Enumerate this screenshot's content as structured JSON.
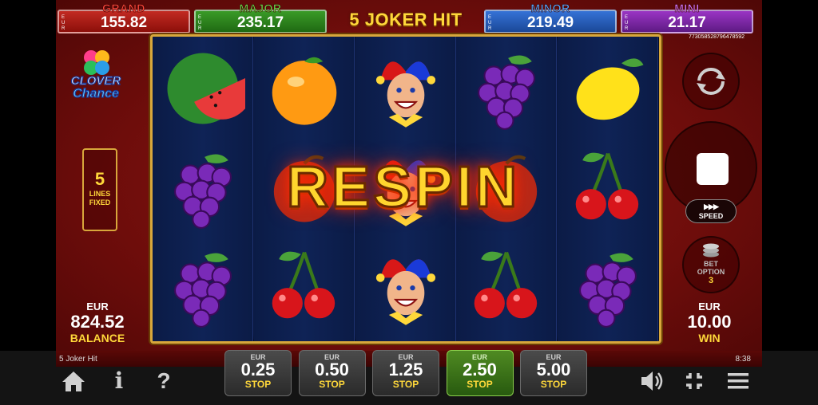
{
  "jackpots": {
    "grand": {
      "label": "GRAND",
      "value": "155.82",
      "currency": "EUR"
    },
    "major": {
      "label": "MAJOR",
      "value": "235.17",
      "currency": "EUR"
    },
    "minor": {
      "label": "MINOR",
      "value": "219.49",
      "currency": "EUR"
    },
    "mini": {
      "label": "MINI",
      "value": "21.17",
      "currency": "EUR"
    }
  },
  "game_title": "5 JOKER HIT",
  "session_id": "773058528796478592",
  "logo": {
    "line1": "CLOVER",
    "line2": "Chance"
  },
  "lines": {
    "count": "5",
    "label1": "LINES",
    "label2": "FIXED"
  },
  "respin_text": "RESPIN",
  "reels": [
    [
      "watermelon",
      "grapes",
      "grapes"
    ],
    [
      "orange",
      "plum",
      "cherries"
    ],
    [
      "joker",
      "joker",
      "joker"
    ],
    [
      "grapes",
      "plum",
      "cherries"
    ],
    [
      "lemon",
      "cherries",
      "grapes"
    ]
  ],
  "balance": {
    "currency": "EUR",
    "amount": "824.52",
    "label": "BALANCE"
  },
  "win": {
    "currency": "EUR",
    "amount": "10.00",
    "label": "WIN"
  },
  "controls": {
    "autoplay_icon": "autoplay-icon",
    "spin_icon": "stop-icon",
    "speed_label": "SPEED",
    "speed_icon": "fast-forward-icon",
    "bet_option_label1": "BET",
    "bet_option_label2": "OPTION",
    "bet_option_value": "3"
  },
  "bets": [
    {
      "currency": "EUR",
      "amount": "0.25",
      "action": "STOP",
      "active": false
    },
    {
      "currency": "EUR",
      "amount": "0.50",
      "action": "STOP",
      "active": false
    },
    {
      "currency": "EUR",
      "amount": "1.25",
      "action": "STOP",
      "active": false
    },
    {
      "currency": "EUR",
      "amount": "2.50",
      "action": "STOP",
      "active": true
    },
    {
      "currency": "EUR",
      "amount": "5.00",
      "action": "STOP",
      "active": false
    }
  ],
  "footer": {
    "game_name": "5 Joker Hit",
    "clock": "8:38",
    "info_label": "i",
    "help_label": "?"
  },
  "colors": {
    "background": "#7a0f0c",
    "gold": "#ffd83a",
    "grand": "#c22a22",
    "major": "#3a9a27",
    "minor": "#3572d6",
    "mini": "#9a35c4",
    "active_bet": "#4f8a22"
  }
}
